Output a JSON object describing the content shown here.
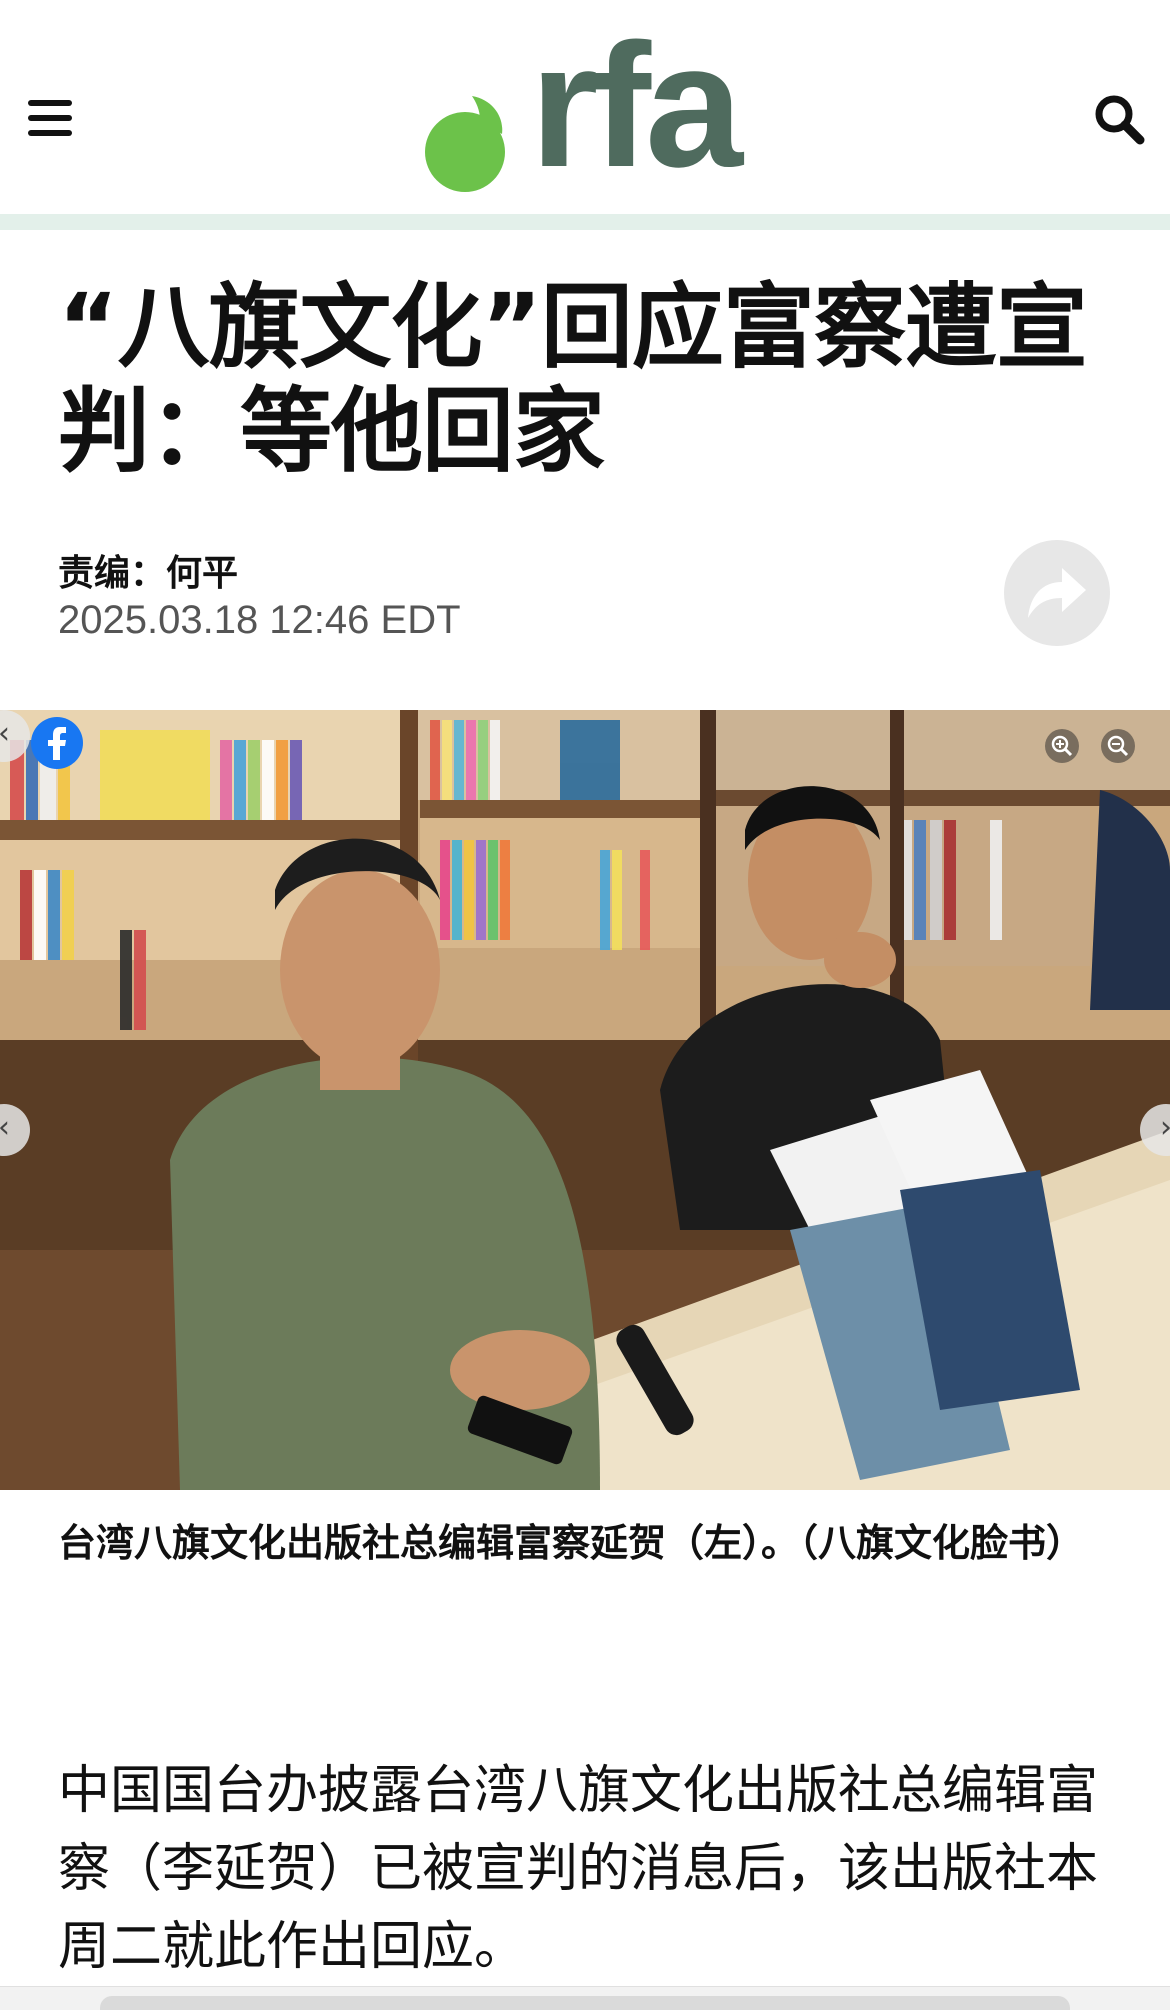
{
  "header": {
    "logo_text": "rfa",
    "menu_icon": "hamburger-menu-icon",
    "search_icon": "search-icon",
    "brand_green": "#6cc24a",
    "brand_gray": "#4f6b5e"
  },
  "article": {
    "title": "“八旗文化”回应富察遭宣判：等他回家",
    "editor": "责编：何平",
    "date": "2025.03.18 12:46 EDT",
    "share_icon": "share-arrow-icon"
  },
  "photo": {
    "social_icon": "facebook-icon",
    "zoom_in_icon": "zoom-in-icon",
    "zoom_out_icon": "zoom-out-icon",
    "prev_icon": "chevron-left-icon",
    "next_icon": "chevron-right-icon",
    "caption": "台湾八旗文化出版社总编辑富察延贺（左）。（八旗文化脸书）"
  },
  "body": {
    "paragraph_1": "中国国台办披露台湾八旗文化出版社总编辑富察（李延贺）已被宣判的消息后，该出版社本周二就此作出回应。"
  }
}
